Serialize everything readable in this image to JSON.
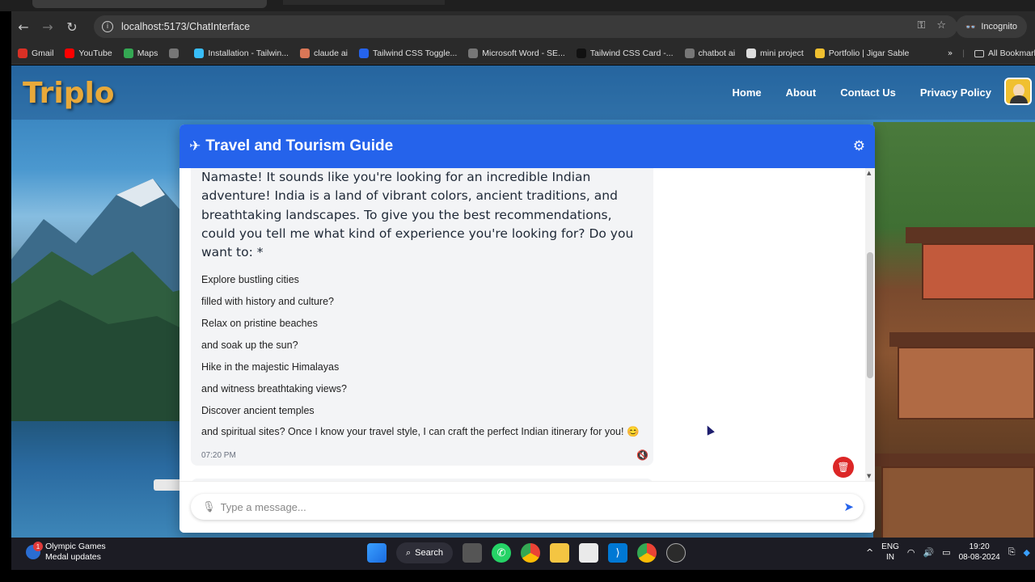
{
  "browser": {
    "url": "localhost:5173/ChatInterface",
    "incognito_label": "Incognito",
    "bookmarks": [
      {
        "label": "Gmail",
        "icon": "gmail-icon",
        "color": "#d93025"
      },
      {
        "label": "YouTube",
        "icon": "youtube-icon",
        "color": "#ff0000"
      },
      {
        "label": "Maps",
        "icon": "maps-icon",
        "color": "#34a853"
      },
      {
        "label": "",
        "icon": "globe-icon",
        "color": "#777777"
      },
      {
        "label": "Installation - Tailwin...",
        "icon": "tailwind-icon",
        "color": "#38bdf8"
      },
      {
        "label": "claude ai",
        "icon": "claude-icon",
        "color": "#d97757"
      },
      {
        "label": "Tailwind CSS Toggle...",
        "icon": "tailwind-toggle-icon",
        "color": "#2563eb"
      },
      {
        "label": "Microsoft Word - SE...",
        "icon": "globe-icon",
        "color": "#777777"
      },
      {
        "label": "Tailwind CSS Card -...",
        "icon": "m-icon",
        "color": "#111111"
      },
      {
        "label": "chatbot ai",
        "icon": "globe-icon",
        "color": "#777777"
      },
      {
        "label": "mini project",
        "icon": "page-icon",
        "color": "#dddddd"
      },
      {
        "label": "Portfolio | Jigar Sable",
        "icon": "portfolio-icon",
        "color": "#f0c030"
      }
    ],
    "all_bookmarks_label": "All Bookmarks"
  },
  "site": {
    "logo": "Triplo",
    "nav": [
      "Home",
      "About",
      "Contact Us",
      "Privacy Policy"
    ]
  },
  "chat": {
    "title": "Travel and Tourism Guide",
    "message": {
      "lead": "Namaste! It sounds like you're looking for an incredible Indian adventure! India is a land of vibrant colors, ancient traditions, and breathtaking landscapes. To give you the best recommendations, could you tell me what kind of experience you're looking for? Do you want to: *",
      "items": [
        "Explore bustling cities",
        "filled with history and culture?",
        "Relax on pristine beaches",
        "and soak up the sun?",
        "Hike in the majestic Himalayas",
        "and witness breathtaking views?",
        "Discover ancient temples",
        "and spiritual sites? Once I know your travel style, I can craft the perfect Indian itinerary for you! 😊"
      ],
      "time": "07:20 PM"
    },
    "input_placeholder": "Type a message..."
  },
  "taskbar": {
    "weather_title": "Olympic Games",
    "weather_sub": "Medal updates",
    "badge": "1",
    "search_label": "Search",
    "lang_top": "ENG",
    "lang_bottom": "IN",
    "time": "19:20",
    "date": "08-08-2024"
  },
  "colors": {
    "header": "#2563eb",
    "logo": "#e8a93a",
    "delete": "#dc2626"
  }
}
